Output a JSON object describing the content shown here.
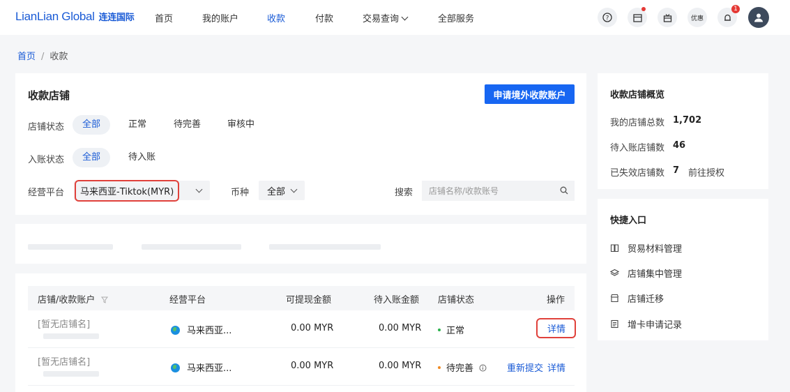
{
  "app": {
    "logo_en": "LianLian Global",
    "logo_cn": "连连国际"
  },
  "nav": {
    "items": [
      "首页",
      "我的账户",
      "收款",
      "付款",
      "交易查询",
      "全部服务"
    ],
    "active_index": 2,
    "coupon_label": "优惠",
    "notification_count": "1"
  },
  "breadcrumb": {
    "home": "首页",
    "sep": "/",
    "current": "收款"
  },
  "stores": {
    "title": "收款店铺",
    "apply_button": "申请境外收款账户",
    "filters": {
      "store_status_label": "店铺状态",
      "store_status_options": [
        "全部",
        "正常",
        "待完善",
        "审核中"
      ],
      "entry_status_label": "入账状态",
      "entry_status_options": [
        "全部",
        "待入账"
      ],
      "platform_label": "经营平台",
      "platform_value": "马来西亚-Tiktok(MYR)",
      "currency_label": "币种",
      "currency_value": "全部",
      "search_label": "搜索",
      "search_placeholder": "店铺名称/收款账号"
    }
  },
  "table": {
    "headers": [
      "店铺/收款账户",
      "经营平台",
      "可提现金额",
      "待入账金额",
      "店铺状态",
      "操作"
    ],
    "rows": [
      {
        "store": "[暂无店铺名]",
        "platform": "马来西亚...",
        "withdrawable": "0.00 MYR",
        "pending": "0.00 MYR",
        "status": "正常",
        "status_color": "#2bb24c",
        "action_detail": "详情",
        "action_resubmit": ""
      },
      {
        "store": "[暂无店铺名]",
        "platform": "马来西亚...",
        "withdrawable": "0.00 MYR",
        "pending": "0.00 MYR",
        "status": "待完善",
        "status_color": "#f08a24",
        "action_detail": "详情",
        "action_resubmit": "重新提交"
      }
    ]
  },
  "overview": {
    "title": "收款店铺概览",
    "total_label": "我的店铺总数",
    "total_value": "1,702",
    "pending_label": "待入账店铺数",
    "pending_value": "46",
    "expired_label": "已失效店铺数",
    "expired_value": "7",
    "reauth_link": "前往授权"
  },
  "quick": {
    "title": "快捷入口",
    "items": [
      "贸易材料管理",
      "店铺集中管理",
      "店铺迁移",
      "增卡申请记录"
    ]
  }
}
